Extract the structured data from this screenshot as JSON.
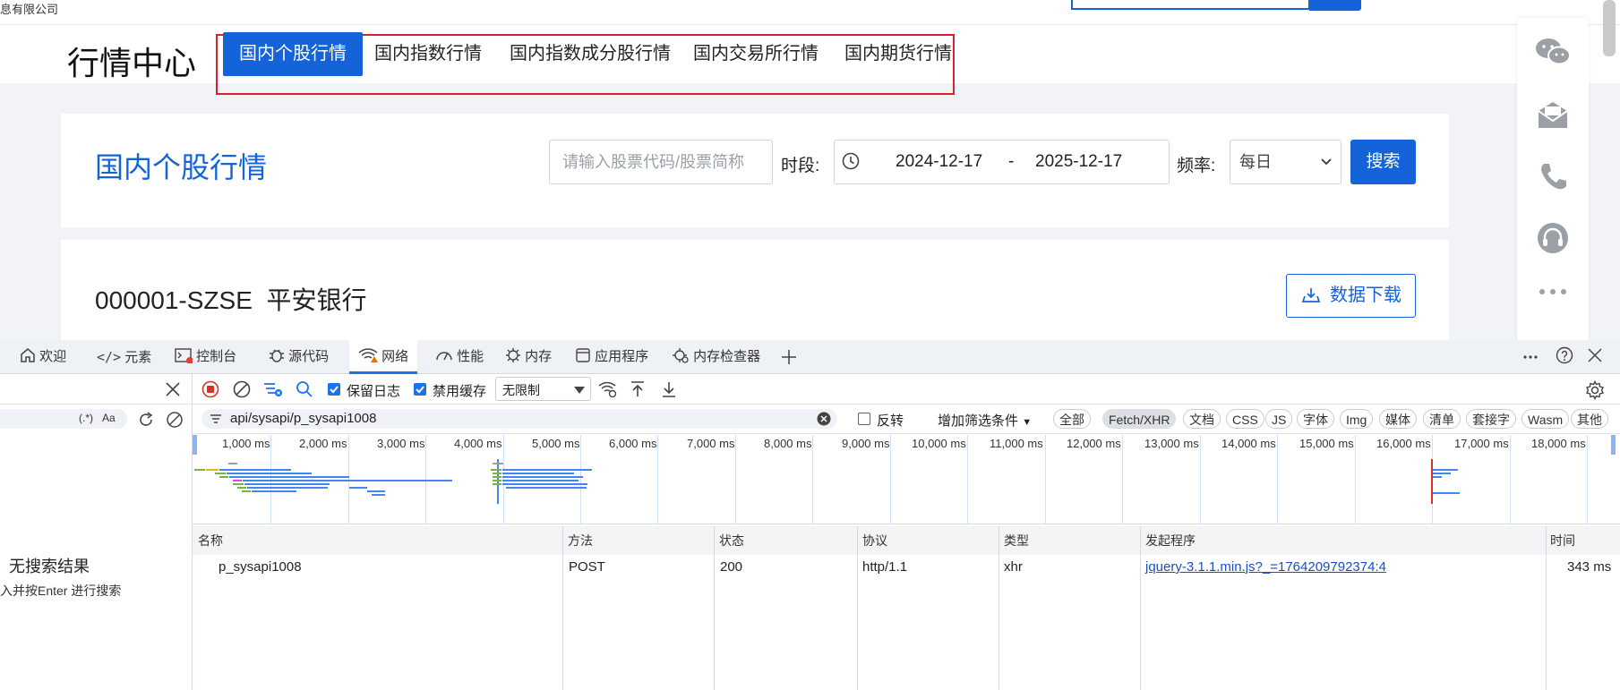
{
  "page": {
    "company_fragment": "息有限公司",
    "brand": "行情中心",
    "nav_tabs": [
      "国内个股行情",
      "国内指数行情",
      "国内指数成分股行情",
      "国内交易所行情",
      "国内期货行情"
    ],
    "panel_title": "国内个股行情",
    "search_placeholder": "请输入股票代码/股票简称",
    "period_label": "时段:",
    "date_start": "2024-12-17",
    "date_sep": "-",
    "date_end": "2025-12-17",
    "freq_label": "频率:",
    "freq_value": "每日",
    "search_button": "搜索",
    "stock_code": "000001-SZSE",
    "stock_name": "平安银行",
    "download_button": "数据下载"
  },
  "devtools": {
    "tabs": [
      "欢迎",
      "元素",
      "控制台",
      "源代码",
      "网络",
      "性能",
      "内存",
      "应用程序",
      "内存检查器"
    ],
    "active_tab": "网络",
    "preserve_log": "保留日志",
    "disable_cache": "禁用缓存",
    "throttle": "无限制",
    "filter_value": "api/sysapi/p_sysapi1008",
    "invert": "反转",
    "more_filters": "增加筛选条件",
    "type_chips": [
      "全部",
      "Fetch/XHR",
      "文档",
      "CSS",
      "JS",
      "字体",
      "Img",
      "媒体",
      "清单",
      "套接字",
      "Wasm",
      "其他"
    ],
    "selected_chip": "Fetch/XHR",
    "search_regex": "(.*)",
    "search_case": "Aa",
    "no_results": "无搜索结果",
    "search_hint": "入并按Enter 进行搜索",
    "timeline_ticks": [
      "1,000 ms",
      "2,000 ms",
      "3,000 ms",
      "4,000 ms",
      "5,000 ms",
      "6,000 ms",
      "7,000 ms",
      "8,000 ms",
      "9,000 ms",
      "10,000 ms",
      "11,000 ms",
      "12,000 ms",
      "13,000 ms",
      "14,000 ms",
      "15,000 ms",
      "16,000 ms",
      "17,000 ms",
      "18,000 ms"
    ],
    "columns": [
      "名称",
      "方法",
      "状态",
      "协议",
      "类型",
      "发起程序",
      "时间"
    ],
    "row": {
      "name": "p_sysapi1008",
      "method": "POST",
      "status": "200",
      "protocol": "http/1.1",
      "type": "xhr",
      "initiator": "jquery-3.1.1.min.js?_=1764209792374:4",
      "time": "343 ms"
    }
  },
  "colors": {
    "accent": "#1563d8",
    "highlight_box": "#d6202b",
    "devtools_blue": "#1a73e8"
  }
}
